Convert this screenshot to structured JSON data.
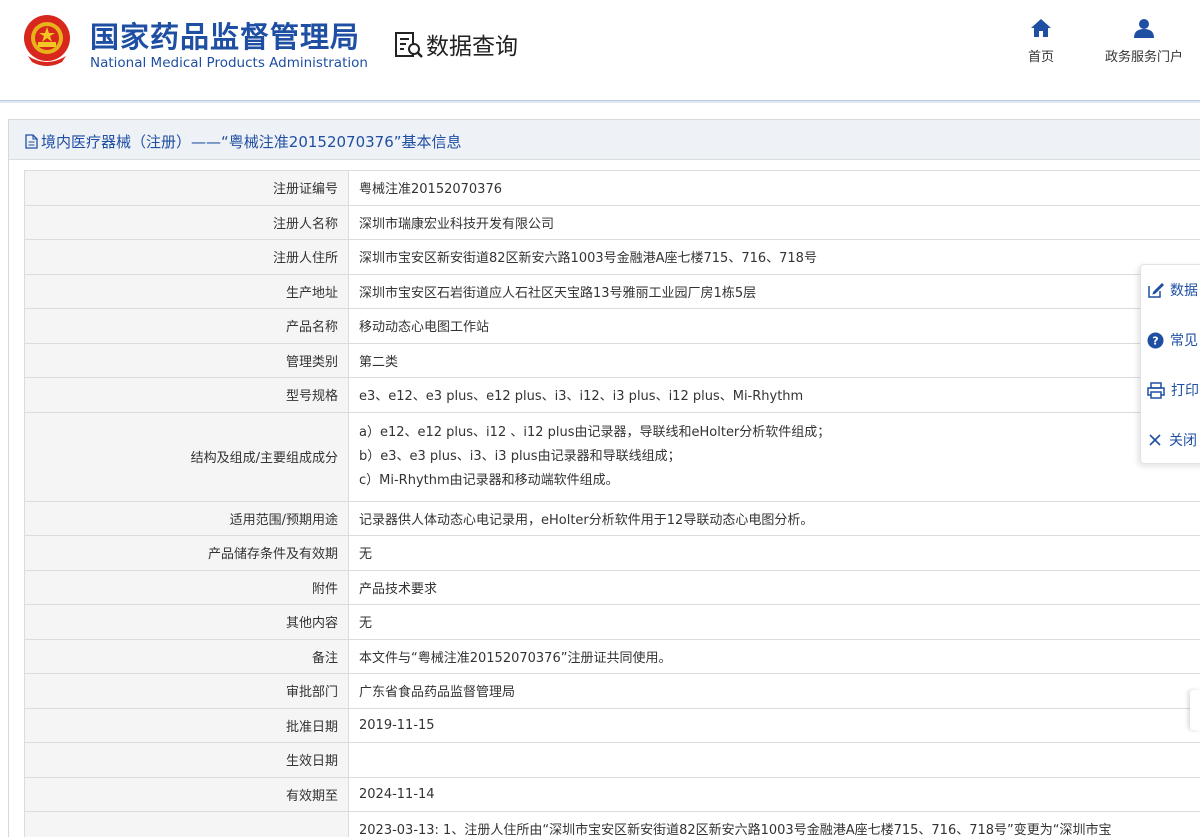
{
  "header": {
    "brand_cn": "国家药品监督管理局",
    "brand_en": "National Medical Products Administration",
    "data_title": "数据查询",
    "nav": [
      {
        "label": "首页",
        "icon": "home-icon"
      },
      {
        "label": "政务服务门户",
        "icon": "user-icon"
      }
    ]
  },
  "panel": {
    "title": "境内医疗器械（注册）——“粤械注准20152070376”基本信息"
  },
  "rows": [
    {
      "label": "注册证编号",
      "value": "粤械注准20152070376"
    },
    {
      "label": "注册人名称",
      "value": "深圳市瑞康宏业科技开发有限公司"
    },
    {
      "label": "注册人住所",
      "value": "深圳市宝安区新安街道82区新安六路1003号金融港A座七楼715、716、718号"
    },
    {
      "label": "生产地址",
      "value": "深圳市宝安区石岩街道应人石社区天宝路13号雅丽工业园厂房1栋5层"
    },
    {
      "label": "产品名称",
      "value": "移动动态心电图工作站"
    },
    {
      "label": "管理类别",
      "value": "第二类"
    },
    {
      "label": "型号规格",
      "value": "e3、e12、e3 plus、e12 plus、i3、i12、i3 plus、i12 plus、Mi-Rhythm"
    },
    {
      "label": "结构及组成/主要组成成分",
      "lines": [
        "a）e12、e12 plus、i12 、i12 plus由记录器，导联线和eHolter分析软件组成；",
        "b）e3、e3 plus、i3、i3 plus由记录器和导联线组成；",
        "c）Mi-Rhythm由记录器和移动端软件组成。"
      ]
    },
    {
      "label": "适用范围/预期用途",
      "value": "记录器供人体动态心电记录用，eHolter分析软件用于12导联动态心电图分析。"
    },
    {
      "label": "产品储存条件及有效期",
      "value": "无"
    },
    {
      "label": "附件",
      "value": "产品技术要求"
    },
    {
      "label": "其他内容",
      "value": "无"
    },
    {
      "label": "备注",
      "value": "本文件与“粤械注准20152070376”注册证共同使用。"
    },
    {
      "label": "审批部门",
      "value": "广东省食品药品监督管理局"
    },
    {
      "label": "批准日期",
      "value": "2019-11-15"
    },
    {
      "label": "生效日期",
      "value": ""
    },
    {
      "label": "有效期至",
      "value": "2024-11-14"
    },
    {
      "label": "",
      "value": "2023-03-13: 1、注册人住所由“深圳市宝安区新安街道82区新安六路1003号金融港A座七楼715、716、718号”变更为“深圳市宝"
    }
  ],
  "side_tools": [
    {
      "label": "数据",
      "icon": "edit-icon"
    },
    {
      "label": "常见",
      "icon": "help-icon"
    },
    {
      "label": "打印",
      "icon": "print-icon"
    },
    {
      "label": "关闭",
      "icon": "close-icon"
    }
  ],
  "colors": {
    "brand": "#1f4fa3",
    "label_bg": "#f5f5f5",
    "border": "#dcdcdc"
  }
}
